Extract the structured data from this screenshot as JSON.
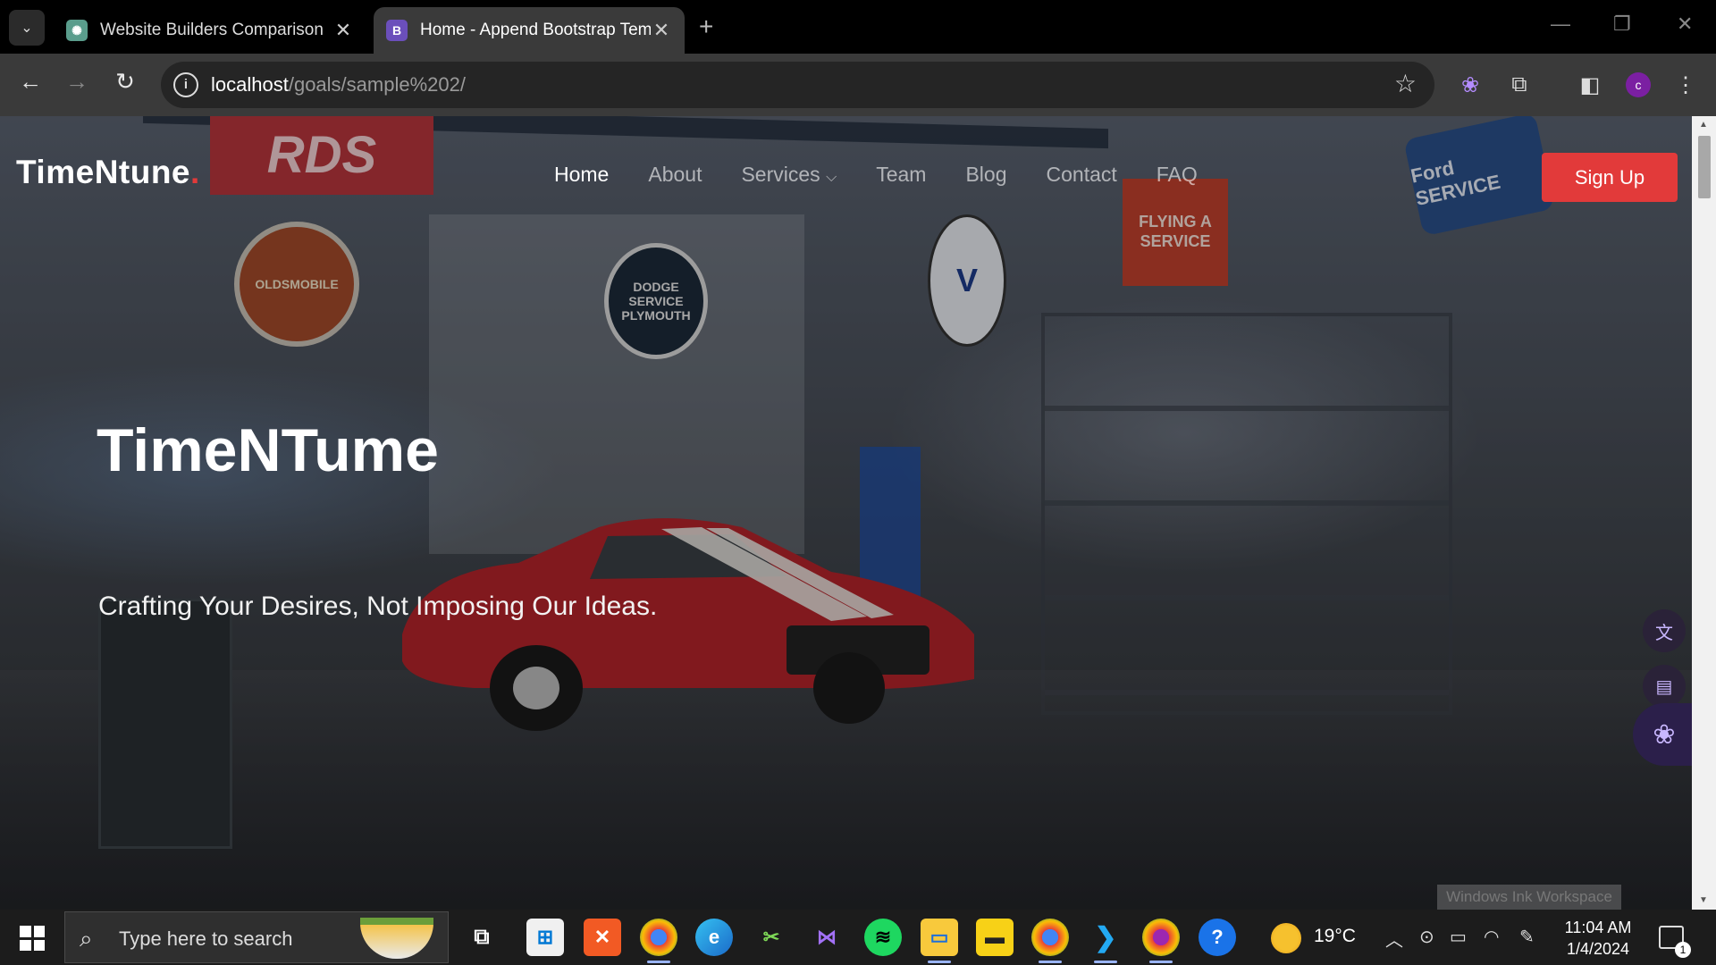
{
  "browser": {
    "tabs": [
      {
        "title": "Website Builders Comparison",
        "favicon": "chatgpt-icon",
        "active": false
      },
      {
        "title": "Home - Append Bootstrap Tem",
        "favicon": "B",
        "active": true
      }
    ],
    "url_host": "localhost",
    "url_path": "/goals/sample%202/",
    "profile_initial": "c"
  },
  "site": {
    "logo": "TimeNtune",
    "logo_dot": ".",
    "nav": [
      {
        "label": "Home",
        "active": true
      },
      {
        "label": "About",
        "active": false
      },
      {
        "label": "Services",
        "active": false,
        "dropdown": true
      },
      {
        "label": "Team",
        "active": false
      },
      {
        "label": "Blog",
        "active": false
      },
      {
        "label": "Contact",
        "active": false
      },
      {
        "label": "FAQ",
        "active": false
      }
    ],
    "signup_label": "Sign Up",
    "hero_title": "TimeNTume",
    "hero_subtitle": "Crafting Your Desires, Not Imposing Our Ideas.",
    "accent_color": "#e23a3a"
  },
  "scene_signs": {
    "rds": "RDS",
    "olds": "OLDSMOBILE",
    "dodge": "DODGE SERVICE PLYMOUTH",
    "valvoline": "V",
    "flying": "FLYING A SERVICE",
    "ford": "Ford SERVICE"
  },
  "overlay": {
    "ink_workspace": "Windows Ink Workspace"
  },
  "taskbar": {
    "search_placeholder": "Type here to search",
    "temperature": "19°C",
    "time": "11:04 AM",
    "date": "1/4/2024",
    "notification_count": "1"
  }
}
